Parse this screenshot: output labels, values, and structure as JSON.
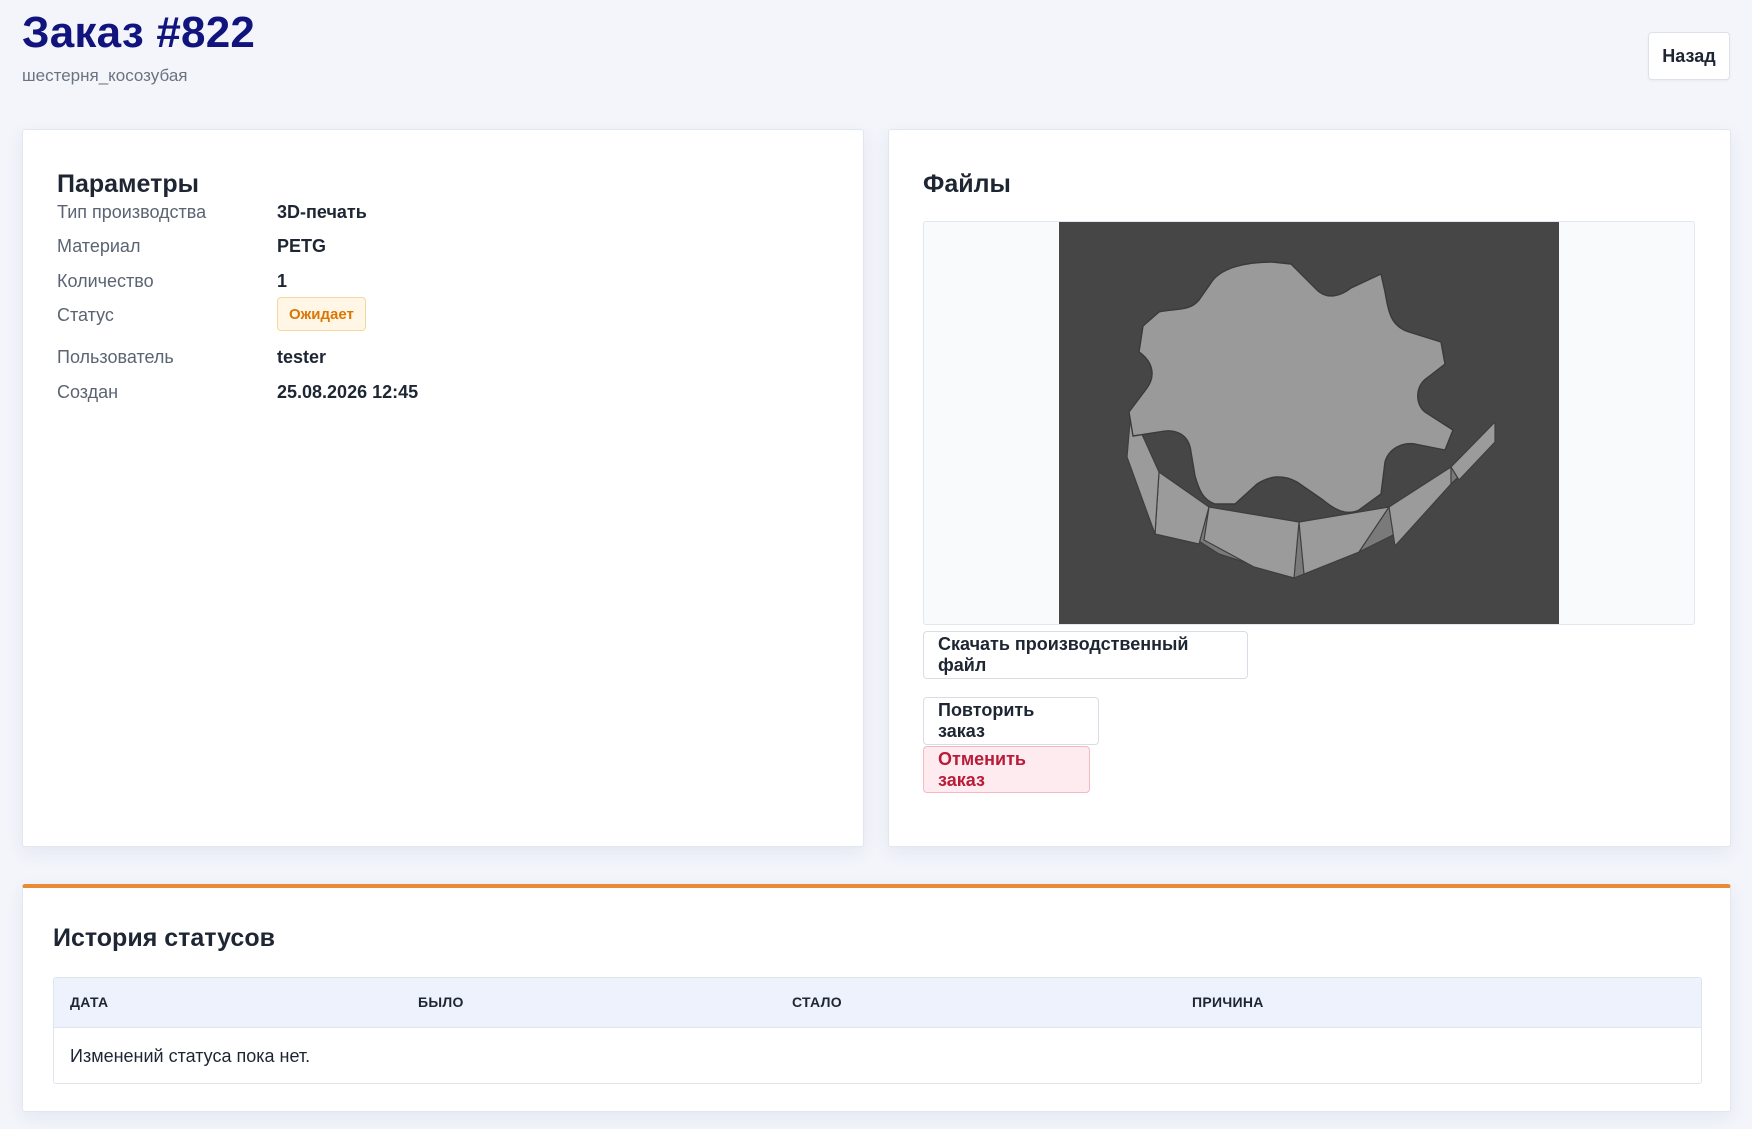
{
  "header": {
    "title": "Заказ #822",
    "subtitle": "шестерня_косозубая",
    "back_label": "Назад"
  },
  "params": {
    "title": "Параметры",
    "rows": [
      {
        "label": "Тип производства",
        "value": "3D-печать"
      },
      {
        "label": "Материал",
        "value": "PETG"
      },
      {
        "label": "Количество",
        "value": "1"
      },
      {
        "label": "Статус",
        "value": "Ожидает"
      },
      {
        "label": "Пользователь",
        "value": "tester"
      },
      {
        "label": "Создан",
        "value": "25.08.2026 12:45"
      }
    ]
  },
  "files": {
    "title": "Файлы",
    "preview_icon": "gear-model-preview",
    "download_label": "Скачать производственный файл",
    "repeat_label": "Повторить заказ",
    "cancel_label": "Отменить заказ"
  },
  "history": {
    "title": "История статусов",
    "columns": [
      "ДАТА",
      "БЫЛО",
      "СТАЛО",
      "ПРИЧИНА"
    ],
    "empty_text": "Изменений статуса пока нет."
  },
  "colors": {
    "title": "#10147c",
    "accent": "#ea8a36",
    "status_pending": "#d97706",
    "danger": "#b91c38"
  }
}
